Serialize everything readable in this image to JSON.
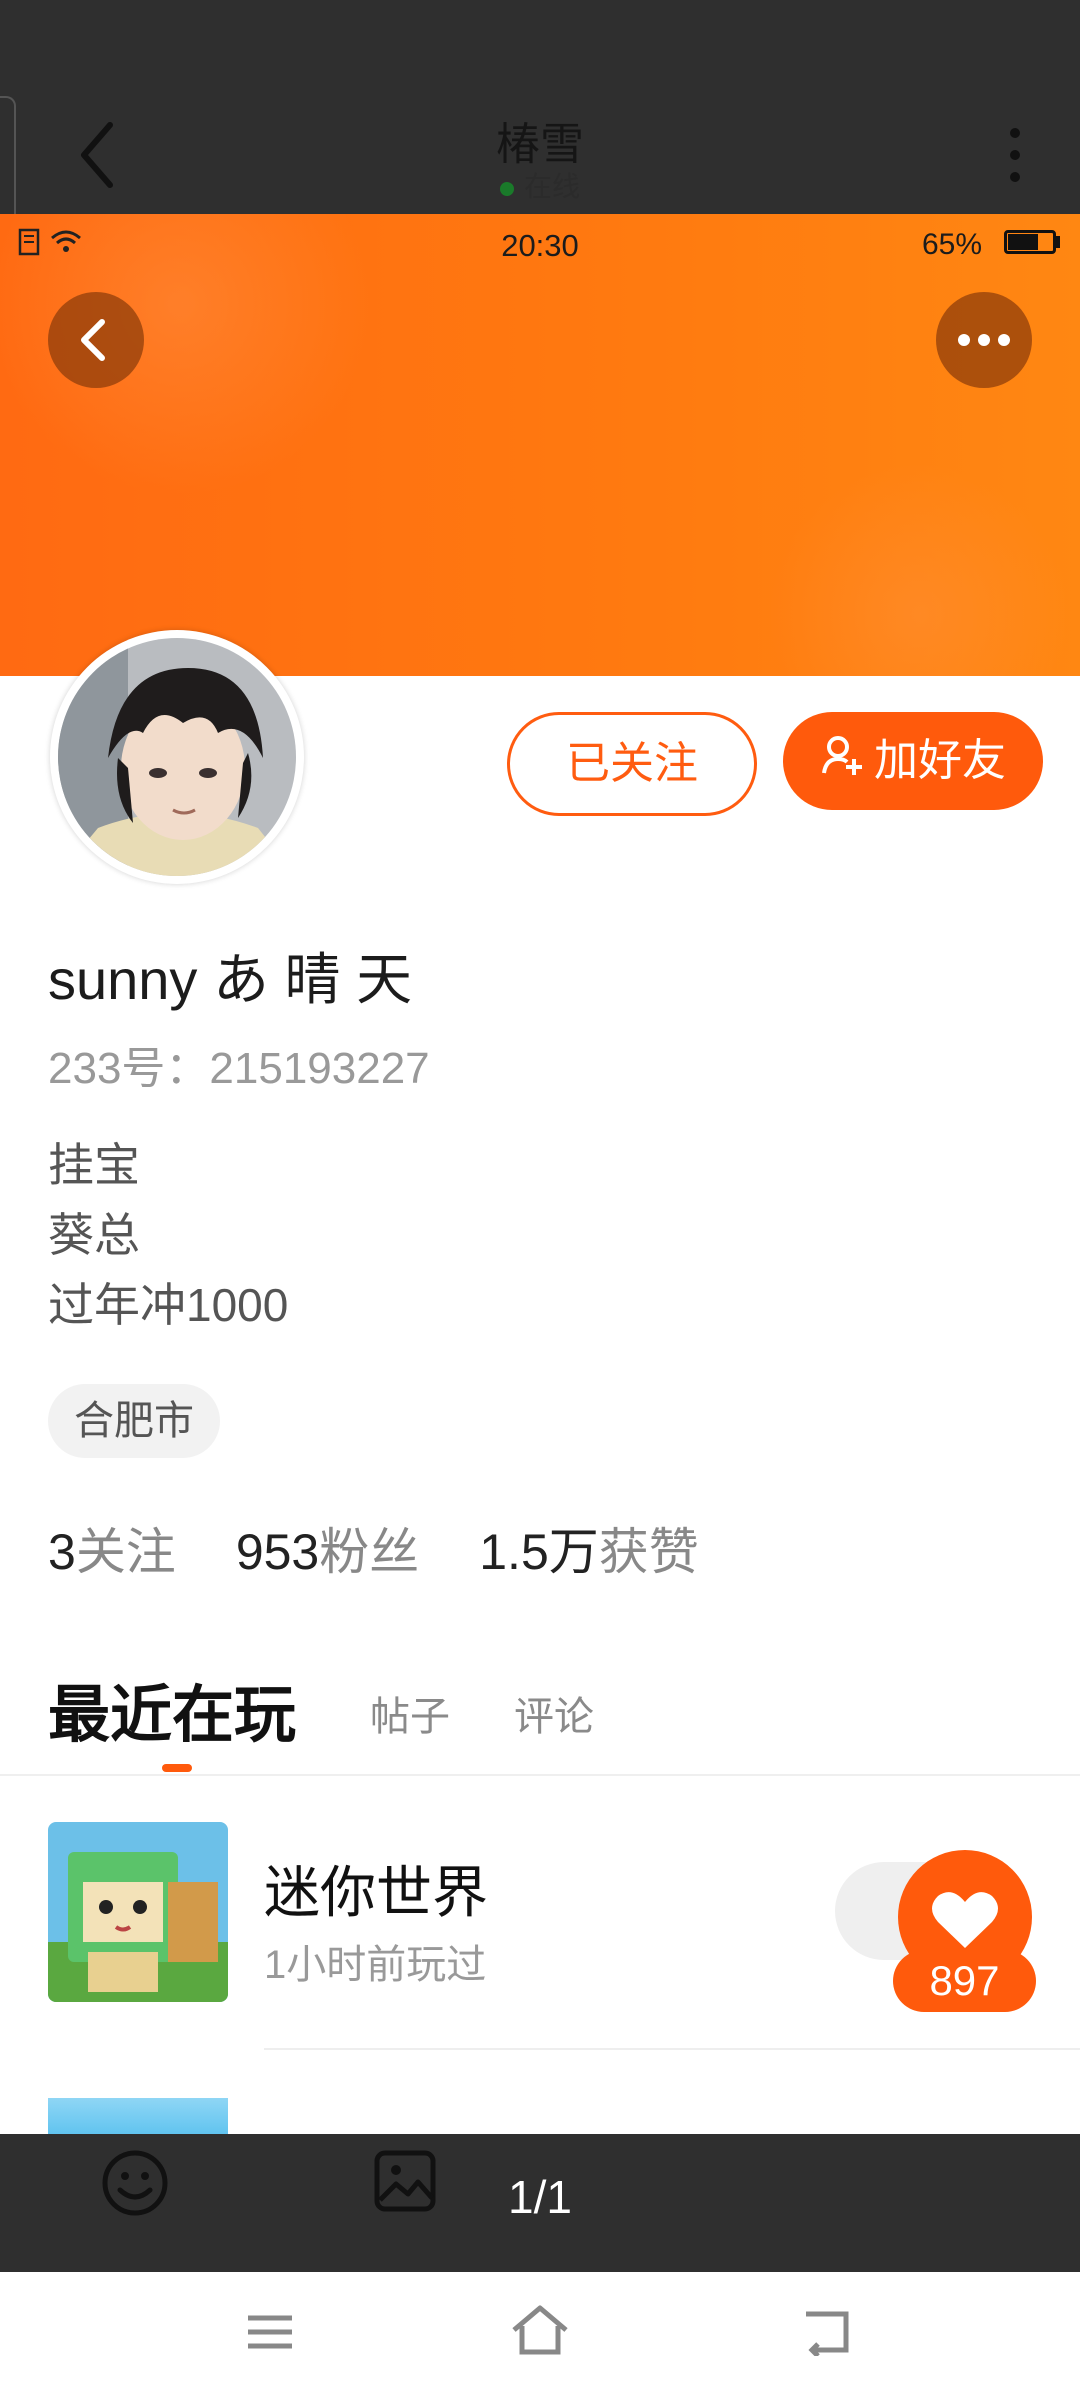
{
  "viewer": {
    "title": "椿雪",
    "subtitle": "在线",
    "page_indicator": "1/1"
  },
  "status_bar": {
    "time": "20:30",
    "battery": "65%"
  },
  "profile": {
    "follow_state_label": "已关注",
    "add_friend_label": "加好友",
    "username": "sunny あ 晴 天",
    "id_line": "233号：215193227",
    "bio_lines": [
      "挂宝",
      "葵总",
      "过年冲1000"
    ],
    "location": "合肥市",
    "stats": {
      "following_count": "3",
      "following_label": "关注",
      "fans_count": "953",
      "fans_label": "粉丝",
      "likes_count": "1.5万",
      "likes_label": "获赞"
    }
  },
  "tabs": {
    "active": "最近在玩",
    "posts": "帖子",
    "comments": "评论"
  },
  "recent_games": [
    {
      "name": "迷你世界",
      "time": "1小时前玩过"
    }
  ],
  "like_button": {
    "count": "897"
  },
  "colors": {
    "accent": "#ff5a0c",
    "hero_start": "#ff6a12",
    "hero_end": "#ff8712",
    "viewer_bar": "#2f2f2f"
  }
}
